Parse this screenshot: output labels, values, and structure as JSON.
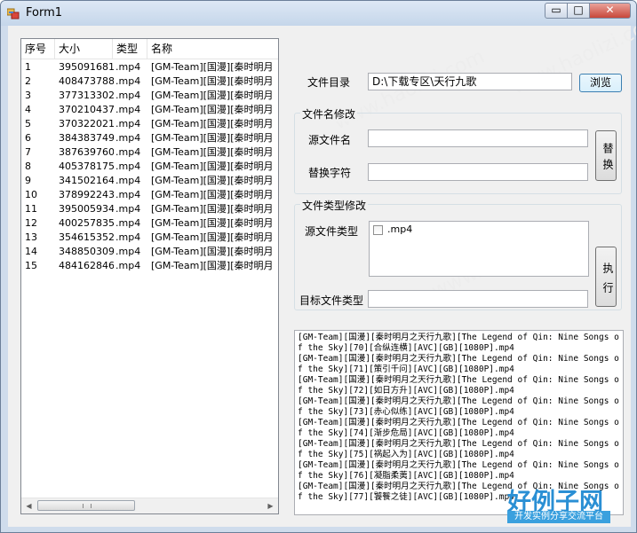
{
  "window": {
    "title": "Form1",
    "min": "▭",
    "max": "□",
    "close": "✕"
  },
  "listview": {
    "columns": [
      "序号",
      "大小",
      "类型",
      "名称"
    ],
    "rows": [
      [
        "1",
        "395091681",
        ".mp4",
        "[GM-Team][国漫][秦时明月"
      ],
      [
        "2",
        "408473788",
        ".mp4",
        "[GM-Team][国漫][秦时明月"
      ],
      [
        "3",
        "377313302",
        ".mp4",
        "[GM-Team][国漫][秦时明月"
      ],
      [
        "4",
        "370210437",
        ".mp4",
        "[GM-Team][国漫][秦时明月"
      ],
      [
        "5",
        "370322021",
        ".mp4",
        "[GM-Team][国漫][秦时明月"
      ],
      [
        "6",
        "384383749",
        ".mp4",
        "[GM-Team][国漫][秦时明月"
      ],
      [
        "7",
        "387639760",
        ".mp4",
        "[GM-Team][国漫][秦时明月"
      ],
      [
        "8",
        "405378175",
        ".mp4",
        "[GM-Team][国漫][秦时明月"
      ],
      [
        "9",
        "341502164",
        ".mp4",
        "[GM-Team][国漫][秦时明月"
      ],
      [
        "10",
        "378992243",
        ".mp4",
        "[GM-Team][国漫][秦时明月"
      ],
      [
        "11",
        "395005934",
        ".mp4",
        "[GM-Team][国漫][秦时明月"
      ],
      [
        "12",
        "400257835",
        ".mp4",
        "[GM-Team][国漫][秦时明月"
      ],
      [
        "13",
        "354615352",
        ".mp4",
        "[GM-Team][国漫][秦时明月"
      ],
      [
        "14",
        "348850309",
        ".mp4",
        "[GM-Team][国漫][秦时明月"
      ],
      [
        "15",
        "484162846",
        ".mp4",
        "[GM-Team][国漫][秦时明月"
      ]
    ],
    "scroll_left": "◀",
    "scroll_right": "▶"
  },
  "dir": {
    "label": "文件目录",
    "value": "D:\\下载专区\\天行九歌",
    "browse": "浏览"
  },
  "rename": {
    "group_title": "文件名修改",
    "source_label": "源文件名",
    "source_value": "",
    "replace_label": "替换字符",
    "replace_value": "",
    "button": "替换"
  },
  "type": {
    "group_title": "文件类型修改",
    "source_label": "源文件类型",
    "items": [
      ".mp4"
    ],
    "target_label": "目标文件类型",
    "target_value": "",
    "button": "执行"
  },
  "output": {
    "lines": [
      "[GM-Team][国漫][秦时明月之天行九歌][The Legend of Qin: Nine Songs of the Sky][70][合纵连横][AVC][GB][1080P].mp4",
      "[GM-Team][国漫][秦时明月之天行九歌][The Legend of Qin: Nine Songs of the Sky][71][策引千问][AVC][GB][1080P].mp4",
      "[GM-Team][国漫][秦时明月之天行九歌][The Legend of Qin: Nine Songs of the Sky][72][如日方升][AVC][GB][1080P].mp4",
      "[GM-Team][国漫][秦时明月之天行九歌][The Legend of Qin: Nine Songs of the Sky][73][赤心似练][AVC][GB][1080P].mp4",
      "[GM-Team][国漫][秦时明月之天行九歌][The Legend of Qin: Nine Songs of the Sky][74][渐步危局][AVC][GB][1080P].mp4",
      "[GM-Team][国漫][秦时明月之天行九歌][The Legend of Qin: Nine Songs of the Sky][75][祸起入为][AVC][GB][1080P].mp4",
      "[GM-Team][国漫][秦时明月之天行九歌][The Legend of Qin: Nine Songs of the Sky][76][凝脂柔荑][AVC][GB][1080P].mp4",
      "[GM-Team][国漫][秦时明月之天行九歌][The Legend of Qin: Nine Songs of the Sky][77][饕餮之徒][AVC][GB][1080P].mp4"
    ]
  },
  "watermark": {
    "text": "www.haolizi.com",
    "logo_main": "好例子网",
    "logo_sub": "开发实例分享交流平台"
  },
  "colors": {
    "titlebar": "#c5d6ea",
    "close": "#c8473a",
    "logo": "#2a8fd4"
  }
}
